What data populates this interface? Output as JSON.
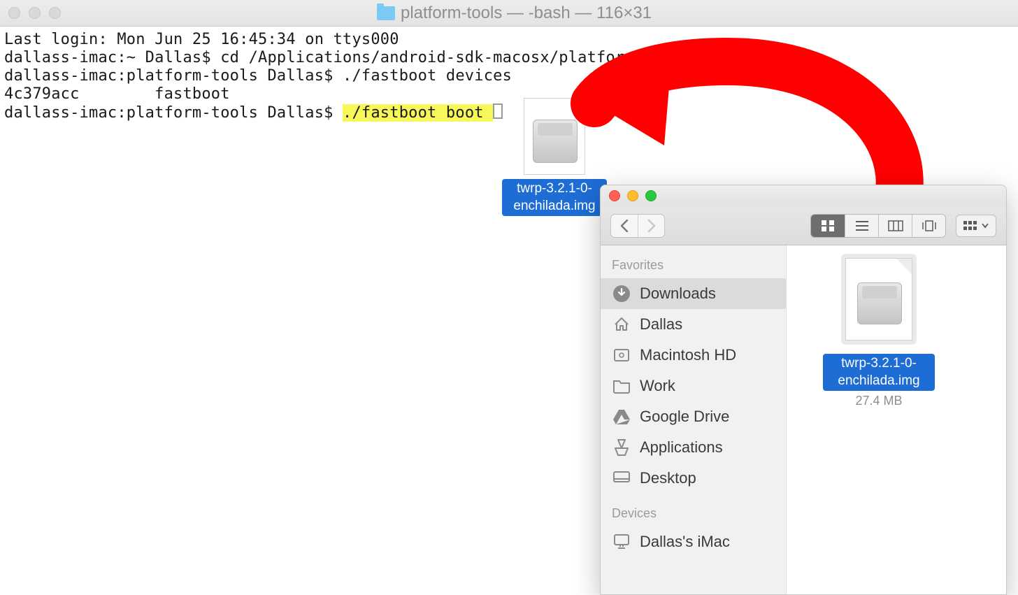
{
  "terminal": {
    "title": "platform-tools — -bash — 116×31",
    "lines": {
      "l1": "Last login: Mon Jun 25 16:45:34 on ttys000",
      "l2": "dallass-imac:~ Dallas$ cd /Applications/android-sdk-macosx/platform-tools",
      "l3": "dallass-imac:platform-tools Dallas$ ./fastboot devices",
      "l4": "4c379acc        fastboot",
      "l5_prefix": "dallass-imac:platform-tools Dallas$ ",
      "l5_cmd": "./fastboot boot "
    }
  },
  "drag_file": {
    "name": "twrp-3.2.1-0-enchilada.img"
  },
  "finder": {
    "sidebar": {
      "favorites_label": "Favorites",
      "items": [
        {
          "label": "Downloads"
        },
        {
          "label": "Dallas"
        },
        {
          "label": "Macintosh HD"
        },
        {
          "label": "Work"
        },
        {
          "label": "Google Drive"
        },
        {
          "label": "Applications"
        },
        {
          "label": "Desktop"
        }
      ],
      "devices_label": "Devices",
      "devices": [
        {
          "label": "Dallas's iMac"
        }
      ]
    },
    "file": {
      "name": "twrp-3.2.1-0-enchilada.img",
      "size": "27.4 MB"
    }
  }
}
